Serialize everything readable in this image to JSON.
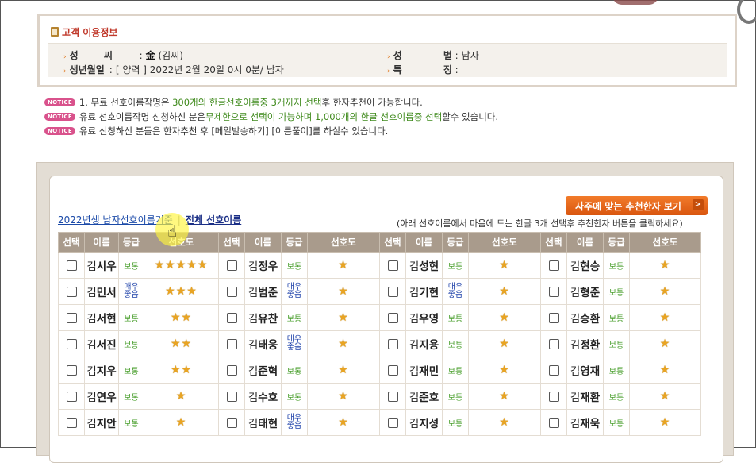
{
  "customer": {
    "title": "고객 이용정보",
    "surname_label": "성 씨",
    "surname_sep": ":",
    "surname_han": "金",
    "surname_value": "(김씨)",
    "gender_label": "성 별",
    "gender_sep": ":",
    "gender_value": "남자",
    "birth_label": "생년월일",
    "birth_sep": ":",
    "birth_value": "[ 양력 ] 2022년 2월 20일 0시 0분/ 남자",
    "feature_label": "특 징",
    "feature_sep": ":",
    "feature_value": ""
  },
  "notices": {
    "badge": "NOTICE",
    "n1_a": "1. 무료 선호이름작명은 ",
    "n1_b": "300개의 한글선호이름중 3개까지 선택",
    "n1_c": "후 한자추천이 가능합니다.",
    "n2_a": "유료 선호이름작명 신청하신 분은",
    "n2_b": "무제한으로 선택이 가능하며 1,000개의 한글 선호이름중 선택",
    "n2_c": "할수 있습니다.",
    "n3": "유료 신청하신 분들은 한자추천 후 [메일발송하기] [이름풀이]를 하실수 있습니다."
  },
  "toolbar": {
    "recommend_button": "사주에 맞는 추천한자 보기",
    "recommend_chev": ">",
    "filter_year": "2022년생 남자선호이름기준",
    "filter_sep": "|",
    "filter_all": "전체 선호이름",
    "hint": "(아래 선호이름에서 마음에 드는 한글 3개 선택후 추천한자 버튼을 클릭하세요)"
  },
  "table": {
    "headers": {
      "select": "선택",
      "name": "이름",
      "grade": "등급",
      "pref": "선호도"
    },
    "grade_normal": "보통",
    "grade_good": "매우좋음",
    "rows": [
      [
        {
          "fam": "김",
          "given": "시우",
          "grade": "보통",
          "stars": 5
        },
        {
          "fam": "김",
          "given": "정우",
          "grade": "보통",
          "stars": 1
        },
        {
          "fam": "김",
          "given": "성현",
          "grade": "보통",
          "stars": 1
        },
        {
          "fam": "김",
          "given": "현승",
          "grade": "보통",
          "stars": 1
        }
      ],
      [
        {
          "fam": "김",
          "given": "민서",
          "grade": "매우좋음",
          "stars": 3
        },
        {
          "fam": "김",
          "given": "범준",
          "grade": "매우좋음",
          "stars": 1
        },
        {
          "fam": "김",
          "given": "기현",
          "grade": "매우좋음",
          "stars": 1
        },
        {
          "fam": "김",
          "given": "형준",
          "grade": "보통",
          "stars": 1
        }
      ],
      [
        {
          "fam": "김",
          "given": "서현",
          "grade": "보통",
          "stars": 2
        },
        {
          "fam": "김",
          "given": "유찬",
          "grade": "보통",
          "stars": 1
        },
        {
          "fam": "김",
          "given": "우영",
          "grade": "보통",
          "stars": 1
        },
        {
          "fam": "김",
          "given": "승환",
          "grade": "보통",
          "stars": 1
        }
      ],
      [
        {
          "fam": "김",
          "given": "서진",
          "grade": "보통",
          "stars": 2
        },
        {
          "fam": "김",
          "given": "태웅",
          "grade": "매우좋음",
          "stars": 1
        },
        {
          "fam": "김",
          "given": "지용",
          "grade": "보통",
          "stars": 1
        },
        {
          "fam": "김",
          "given": "정환",
          "grade": "보통",
          "stars": 1
        }
      ],
      [
        {
          "fam": "김",
          "given": "지우",
          "grade": "보통",
          "stars": 2
        },
        {
          "fam": "김",
          "given": "준혁",
          "grade": "보통",
          "stars": 1
        },
        {
          "fam": "김",
          "given": "재민",
          "grade": "보통",
          "stars": 1
        },
        {
          "fam": "김",
          "given": "영재",
          "grade": "보통",
          "stars": 1
        }
      ],
      [
        {
          "fam": "김",
          "given": "연우",
          "grade": "보통",
          "stars": 1
        },
        {
          "fam": "김",
          "given": "수호",
          "grade": "보통",
          "stars": 1
        },
        {
          "fam": "김",
          "given": "준호",
          "grade": "보통",
          "stars": 1
        },
        {
          "fam": "김",
          "given": "재환",
          "grade": "보통",
          "stars": 1
        }
      ],
      [
        {
          "fam": "김",
          "given": "지안",
          "grade": "보통",
          "stars": 1
        },
        {
          "fam": "김",
          "given": "태현",
          "grade": "매우좋음",
          "stars": 1
        },
        {
          "fam": "김",
          "given": "지성",
          "grade": "보통",
          "stars": 1
        },
        {
          "fam": "김",
          "given": "재욱",
          "grade": "보통",
          "stars": 1
        }
      ]
    ]
  },
  "icons": {
    "title_icon": "clipboard-icon",
    "pointer": "hand-pointer-icon",
    "star": "star-icon"
  },
  "colors": {
    "accent": "#d9560f",
    "header_bg": "#a99b8c",
    "title_red": "#c0392b",
    "normal_green": "#4a9f2d",
    "good_blue": "#1b3fa8"
  }
}
